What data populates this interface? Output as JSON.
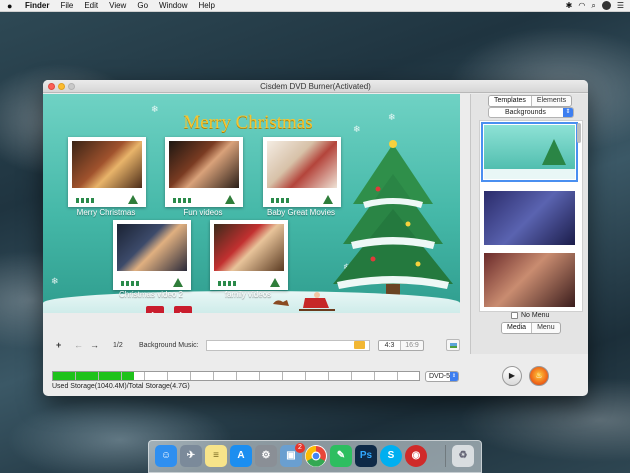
{
  "menubar": {
    "apple": "",
    "items": [
      "Finder",
      "File",
      "Edit",
      "View",
      "Go",
      "Window",
      "Help"
    ]
  },
  "window": {
    "title": "Cisdem DVD Burner(Activated)"
  },
  "canvas": {
    "title": "Merry Christmas",
    "thumbnails": [
      {
        "label": "Merry Christmas"
      },
      {
        "label": "Fun videos"
      },
      {
        "label": "Baby Great Movies"
      },
      {
        "label": "Christmas video 2"
      },
      {
        "label": "family videos"
      }
    ]
  },
  "sidebar": {
    "tabs": [
      "Templates",
      "Elements"
    ],
    "category": "Backgrounds",
    "no_menu_label": "No Menu",
    "bottom_tabs": [
      "Media",
      "Menu"
    ]
  },
  "toolbar": {
    "add": "+",
    "prev": "←",
    "next": "→",
    "page": "1/2",
    "background_music_label": "Background Music:",
    "ratio_options": [
      "4:3",
      "16:9"
    ]
  },
  "storage": {
    "used_fraction": 0.22,
    "label": "Used Storage(1040.4M)/Total Storage(4.7G)",
    "disc_type": "DVD-5"
  },
  "dock": {
    "badge_count": "2",
    "apps": [
      {
        "name": "finder-icon",
        "color": "#2f8ff0"
      },
      {
        "name": "launchpad-icon",
        "color": "#7b8a9a"
      },
      {
        "name": "notes-icon",
        "color": "#f7e48a"
      },
      {
        "name": "app-store-icon",
        "color": "#1c8ef0"
      },
      {
        "name": "system-preferences-icon",
        "color": "#8a8f96"
      },
      {
        "name": "preview-icon",
        "color": "#6a9fd0"
      },
      {
        "name": "chrome-icon",
        "color": "#e8463a"
      },
      {
        "name": "evernote-icon",
        "color": "#2dbe60"
      },
      {
        "name": "photoshop-icon",
        "color": "#0e2a47"
      },
      {
        "name": "skype-icon",
        "color": "#00aff0"
      },
      {
        "name": "dvd-burner-icon",
        "color": "#d02a2a"
      },
      {
        "name": "trash-icon",
        "color": "#d9dde0"
      }
    ]
  }
}
